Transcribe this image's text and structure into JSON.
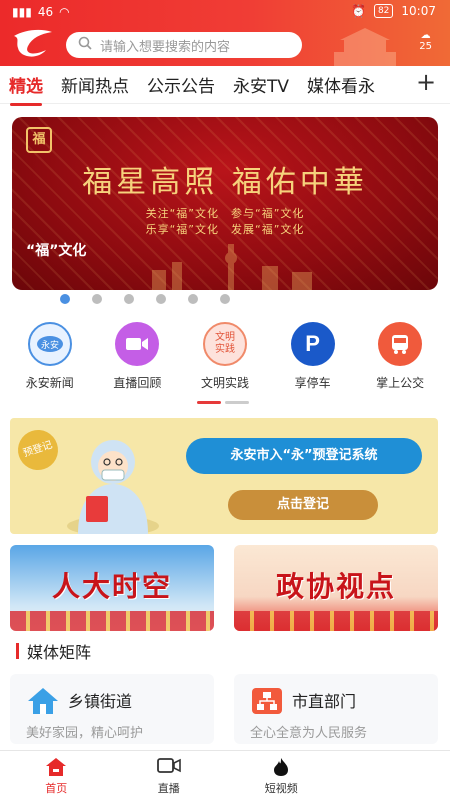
{
  "status_bar": {
    "left": "46",
    "battery": "82",
    "time": "10:07"
  },
  "search": {
    "placeholder": "请输入想要搜索的内容"
  },
  "weather": {
    "temp": "25"
  },
  "tabs": [
    {
      "label": "精选",
      "active": true
    },
    {
      "label": "新闻热点"
    },
    {
      "label": "公示公告"
    },
    {
      "label": "永安TV"
    },
    {
      "label": "媒体看永安"
    }
  ],
  "tab_plus": "+",
  "banner": {
    "title": "福星高照 福佑中華",
    "line1": "关注“福”文化　参与“福”文化",
    "line2": "乐享“福”文化　发展“福”文化",
    "caption": "“福”文化",
    "seal": "福"
  },
  "carousel": {
    "count": 6,
    "active_index": 0
  },
  "quick_links": [
    {
      "label": "永安新闻",
      "icon": "news-icon"
    },
    {
      "label": "直播回顾",
      "icon": "video-camera-icon"
    },
    {
      "label": "文明实践",
      "icon": "civilization-badge-icon",
      "icon_text": "文明实践"
    },
    {
      "label": "享停车",
      "icon": "parking-icon"
    },
    {
      "label": "掌上公交",
      "icon": "bus-icon"
    }
  ],
  "registration": {
    "tag": "预登记",
    "title": "永安市入“永”预登记系统",
    "button": "点击登记"
  },
  "promo_cards": [
    {
      "text": "人大时空"
    },
    {
      "text": "政协视点"
    }
  ],
  "section": {
    "title": "媒体矩阵"
  },
  "matrix": [
    {
      "title": "乡镇街道",
      "desc": "美好家园，精心呵护",
      "icon": "home-icon"
    },
    {
      "title": "市直部门",
      "desc": "全心全意为人民服务",
      "icon": "org-chart-icon"
    }
  ],
  "bottom_nav": [
    {
      "label": "首页",
      "icon": "home-icon",
      "active": true
    },
    {
      "label": "直播",
      "icon": "video-camera-icon"
    },
    {
      "label": "短视频",
      "icon": "flame-icon"
    }
  ],
  "colors": {
    "brand_red": "#e62a2a",
    "accent_blue": "#4a90e2"
  }
}
